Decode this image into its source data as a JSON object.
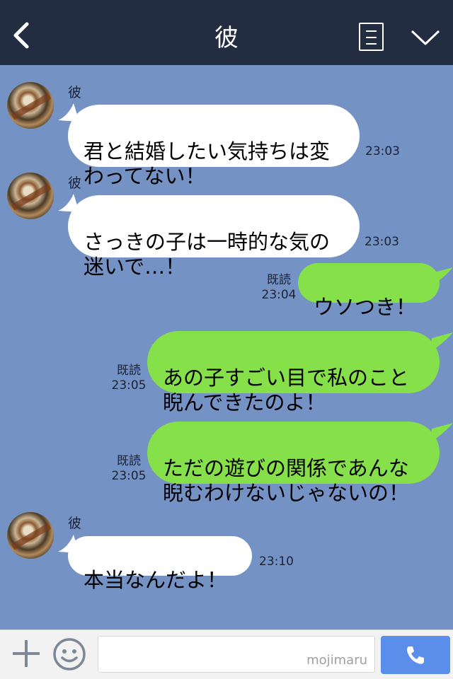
{
  "header": {
    "title": "彼",
    "icons": {
      "back": "back-chevron-icon",
      "menu": "menu-list-icon",
      "dropdown": "chevron-down-icon"
    }
  },
  "messages": [
    {
      "sender": "彼",
      "lines": "君と結婚したい気持ちは変\nわってない！",
      "time": "23:03",
      "direction": "incoming"
    },
    {
      "sender": "彼",
      "lines": "さっきの子は一時的な気の\n迷いで…！",
      "time": "23:03",
      "direction": "incoming"
    },
    {
      "read": "既読",
      "lines": "ウソつき！",
      "time": "23:04",
      "direction": "outgoing"
    },
    {
      "read": "既読",
      "lines": "あの子すごい目で私のこと\n睨んできたのよ！",
      "time": "23:05",
      "direction": "outgoing"
    },
    {
      "read": "既読",
      "lines": "ただの遊びの関係であんな\n睨むわけないじゃないの！",
      "time": "23:05",
      "direction": "outgoing"
    },
    {
      "sender": "彼",
      "lines": "本当なんだよ！",
      "time": "23:10",
      "direction": "incoming"
    }
  ],
  "input": {
    "watermark": "mojimaru"
  },
  "colors": {
    "header": "#232d41",
    "chat_background": "#7492c4",
    "incoming_bubble": "#ffffff",
    "outgoing_bubble": "#86e04a",
    "call_button": "#5b8dea"
  }
}
